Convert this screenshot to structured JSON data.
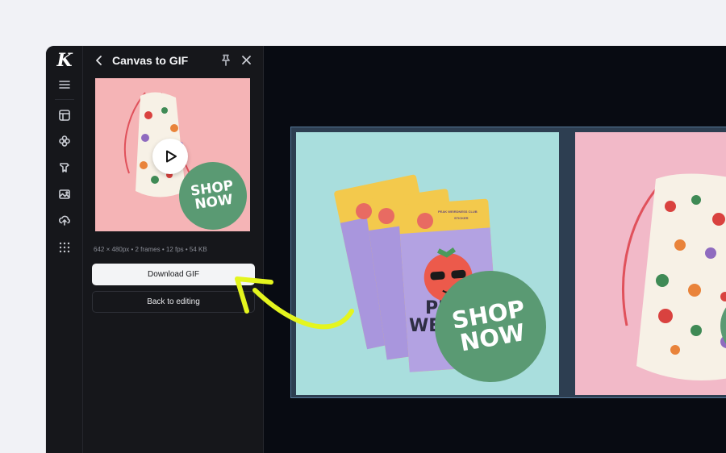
{
  "rail": {
    "logo": "K",
    "icons": [
      "menu-icon",
      "layout-icon",
      "elements-icon",
      "brand-icon",
      "image-icon",
      "upload-icon",
      "apps-grid-icon"
    ]
  },
  "panel": {
    "title": "Canvas to GIF",
    "meta": "642 × 480px • 2 frames • 12 fps • 54 KB",
    "download_label": "Download GIF",
    "back_label": "Back to editing"
  },
  "preview": {
    "badge_line1": "SHOP",
    "badge_line2": "NOW"
  },
  "canvas": {
    "frame1": {
      "badge_line1": "SHOP",
      "badge_line2": "NOW",
      "sticker_text": "PEAK WEIRDNESS CLUB",
      "sticker_sub": "STICKER",
      "sticker_word1": "PE",
      "sticker_word2": "WEIR"
    }
  },
  "colors": {
    "accent_arrow": "#e4f51e",
    "badge_green": "#5a9a73",
    "frame1_bg": "#a9dedd",
    "frame2_bg": "#f2b9c8",
    "preview_bg": "#f5b4b6"
  }
}
